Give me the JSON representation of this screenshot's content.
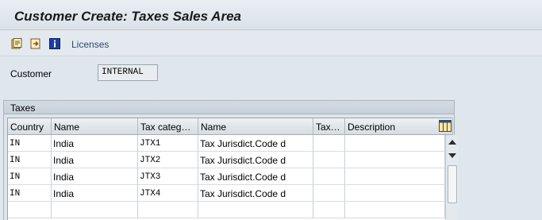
{
  "window": {
    "title": "Customer Create: Taxes Sales Area"
  },
  "toolbar": {
    "icons": [
      "other-data-icon",
      "next-screen-icon",
      "info-icon"
    ],
    "licenses_label": "Licenses"
  },
  "customer": {
    "label": "Customer",
    "value": "INTERNAL"
  },
  "taxes": {
    "title": "Taxes",
    "columns": [
      "Country",
      "Name",
      "Tax categ…",
      "Name",
      "Tax…",
      "Description"
    ],
    "rows": [
      {
        "country": "IN",
        "name": "India",
        "tax_category": "JTX1",
        "category_name": "Tax Jurisdict.Code d",
        "tax": "",
        "description": ""
      },
      {
        "country": "IN",
        "name": "India",
        "tax_category": "JTX2",
        "category_name": "Tax Jurisdict.Code d",
        "tax": "",
        "description": ""
      },
      {
        "country": "IN",
        "name": "India",
        "tax_category": "JTX3",
        "category_name": "Tax Jurisdict.Code d",
        "tax": "",
        "description": ""
      },
      {
        "country": "IN",
        "name": "India",
        "tax_category": "JTX4",
        "category_name": "Tax Jurisdict.Code d",
        "tax": "",
        "description": ""
      }
    ]
  },
  "colors": {
    "accent": "#2a4b6e",
    "background": "#dfe6ec"
  }
}
